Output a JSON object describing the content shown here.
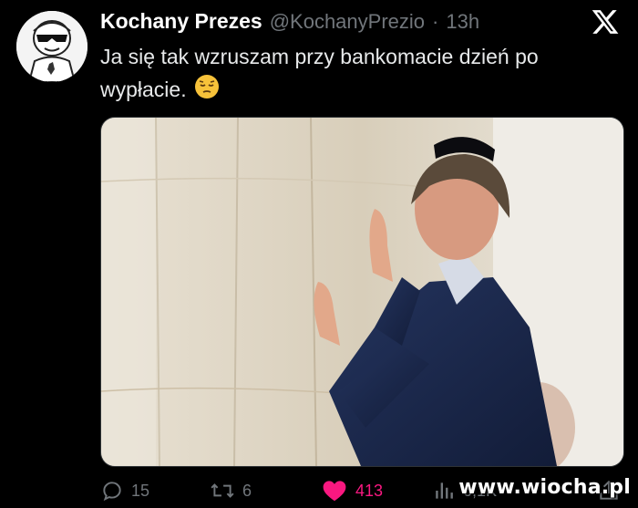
{
  "tweet": {
    "author_name": "Kochany Prezes",
    "handle": "@KochanyPrezio",
    "separator": "·",
    "time": "13h",
    "text": "Ja się tak wzruszam przy bankomacie dzień po wypłacie.",
    "emoji": "pensive-face"
  },
  "actions": {
    "replies": "15",
    "reposts": "6",
    "likes": "413",
    "views": "6,1K"
  },
  "colors": {
    "background": "#000000",
    "text": "#e7e9ea",
    "muted": "#71767b",
    "like": "#f91880"
  },
  "watermark": "www.wiocha.pl"
}
